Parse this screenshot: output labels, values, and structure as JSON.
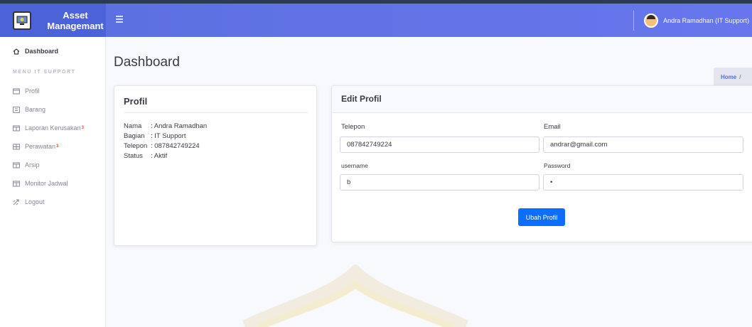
{
  "brand": {
    "line1": "Asset",
    "line2": "Managemant"
  },
  "topbar": {
    "user_name": "Andra Ramadhan (IT Support)"
  },
  "sidebar": {
    "dashboard": "Dashboard",
    "heading": "MENU IT SUPPORT",
    "items": [
      {
        "label": "Profil",
        "icon": "id-card-icon",
        "badge": ""
      },
      {
        "label": "Barang",
        "icon": "box-icon",
        "badge": ""
      },
      {
        "label": "Laporan Kerusakan",
        "icon": "table-icon",
        "badge": "3"
      },
      {
        "label": "Perawatan",
        "icon": "grid-icon",
        "badge": "3"
      },
      {
        "label": "Arsip",
        "icon": "table-icon",
        "badge": ""
      },
      {
        "label": "Monitor Jadwal",
        "icon": "table-icon",
        "badge": ""
      },
      {
        "label": "Logout",
        "icon": "logout-icon",
        "badge": ""
      }
    ]
  },
  "page": {
    "title": "Dashboard"
  },
  "breadcrumb": {
    "home": "Home",
    "separator": "/"
  },
  "profil": {
    "title": "Profil",
    "rows": [
      {
        "key": "Nama",
        "value": ": Andra Ramadhan"
      },
      {
        "key": "Bagian",
        "value": ": IT Support"
      },
      {
        "key": "Telepon",
        "value": ": 087842749224"
      },
      {
        "key": "Status",
        "value": ": Aktif"
      }
    ]
  },
  "edit_profil": {
    "title": "Edit Profil",
    "telepon_label": "Telepon",
    "telepon_value": "087842749224",
    "email_label": "Email",
    "email_value": "andrar@gmail.com",
    "username_label": "username",
    "username_value": "b",
    "password_label": "Password",
    "password_value": "•",
    "submit_label": "Ubah Profil"
  },
  "colors": {
    "topbar": "#5e72e4",
    "brand": "#4c62d8",
    "primary_button": "#0d6efd",
    "badge": "#e74a3b"
  }
}
